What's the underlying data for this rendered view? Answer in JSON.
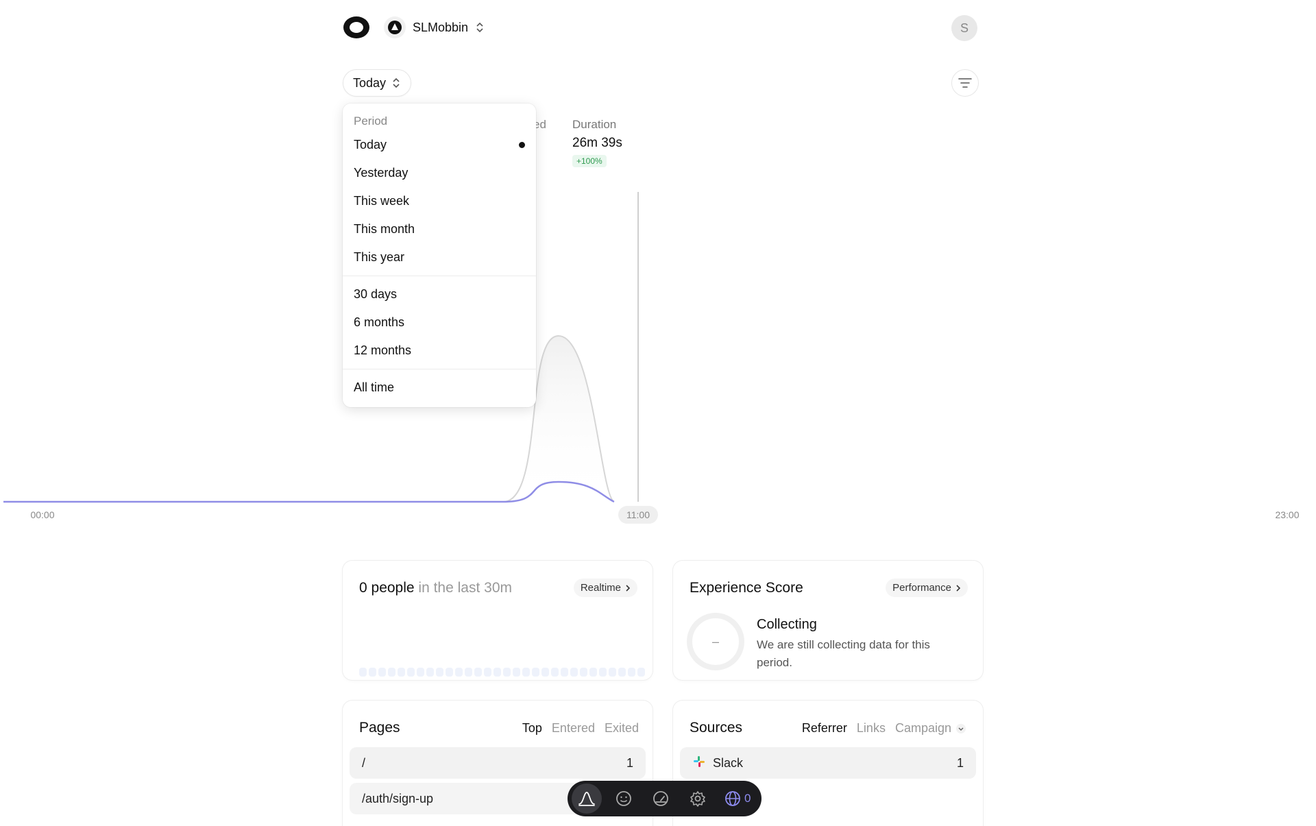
{
  "header": {
    "team_name": "SLMobbin",
    "user_initial": "S"
  },
  "period_button": {
    "label": "Today"
  },
  "metrics": {
    "partial_label": "ed",
    "duration": {
      "label": "Duration",
      "value": "26m 39s",
      "change": "+100%"
    }
  },
  "chart_data": {
    "type": "area",
    "x_ticks": [
      "00:00",
      "11:00",
      "23:00"
    ],
    "highlighted_tick": "11:00",
    "series": [
      {
        "color": "#d6d6d6",
        "x": [
          "00:00",
          "09:00",
          "10:00",
          "11:00"
        ],
        "y": [
          0,
          0,
          1,
          0
        ]
      },
      {
        "color": "#8f8de6",
        "x": [
          "00:00",
          "09:00",
          "10:00",
          "11:00"
        ],
        "y": [
          0,
          0,
          0.12,
          0
        ]
      }
    ],
    "colors": {
      "total": "#d6d6d6",
      "people": "#8f8de6"
    }
  },
  "dropdown": {
    "header": "Period",
    "selected": "Today",
    "groups": [
      [
        "Today",
        "Yesterday",
        "This week",
        "This month",
        "This year"
      ],
      [
        "30 days",
        "6 months",
        "12 months"
      ],
      [
        "All time"
      ]
    ]
  },
  "realtime": {
    "count": "0 people",
    "suffix": "in the last 30m",
    "button": "Realtime"
  },
  "experience": {
    "title": "Experience Score",
    "button": "Performance",
    "score": "–",
    "status": "Collecting",
    "description": "We are still collecting data for this period."
  },
  "pages": {
    "title": "Pages",
    "tabs": [
      "Top",
      "Entered",
      "Exited"
    ],
    "rows": [
      {
        "path": "/",
        "count": "1"
      },
      {
        "path": "/auth/sign-up",
        "count": ""
      }
    ]
  },
  "sources": {
    "title": "Sources",
    "tabs": [
      "Referrer",
      "Links",
      "Campaign"
    ],
    "rows": [
      {
        "name": "Slack",
        "count": "1"
      }
    ]
  },
  "toolbar": {
    "online_count": "0"
  }
}
